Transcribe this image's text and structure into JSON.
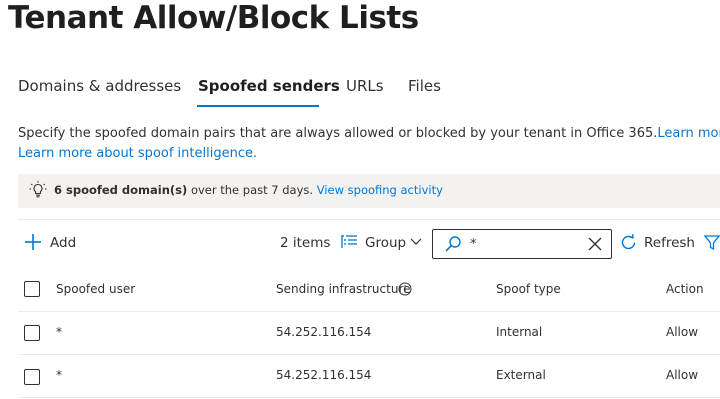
{
  "page": {
    "title": "Tenant Allow/Block Lists"
  },
  "tabs": [
    {
      "label": "Domains & addresses",
      "active": false
    },
    {
      "label": "Spoofed senders",
      "active": true
    },
    {
      "label": "URLs",
      "active": false
    },
    {
      "label": "Files",
      "active": false
    }
  ],
  "description": {
    "text": "Specify the spoofed domain pairs that are always allowed or blocked by your tenant in Office 365.",
    "learn_more": "Learn more.",
    "spoof_link": "Learn more about spoof intelligence."
  },
  "info_bar": {
    "icon": "lightbulb-icon",
    "count_text": "6 spoofed domain(s)",
    "period_text": " over the past 7 days. ",
    "link": "View spoofing activity"
  },
  "toolbar": {
    "add_label": "Add",
    "items_count": "2 items",
    "group_label": "Group",
    "search_value": "*",
    "refresh_label": "Refresh"
  },
  "table": {
    "columns": [
      "Spoofed user",
      "Sending infrastructure",
      "Spoof type",
      "Action"
    ],
    "rows": [
      {
        "user": "*",
        "infrastructure": "54.252.116.154",
        "type": "Internal",
        "action": "Allow"
      },
      {
        "user": "*",
        "infrastructure": "54.252.116.154",
        "type": "External",
        "action": "Allow"
      }
    ]
  },
  "colors": {
    "accent": "#0078d4",
    "text": "#323130",
    "info_bg": "#f3f2f1"
  }
}
